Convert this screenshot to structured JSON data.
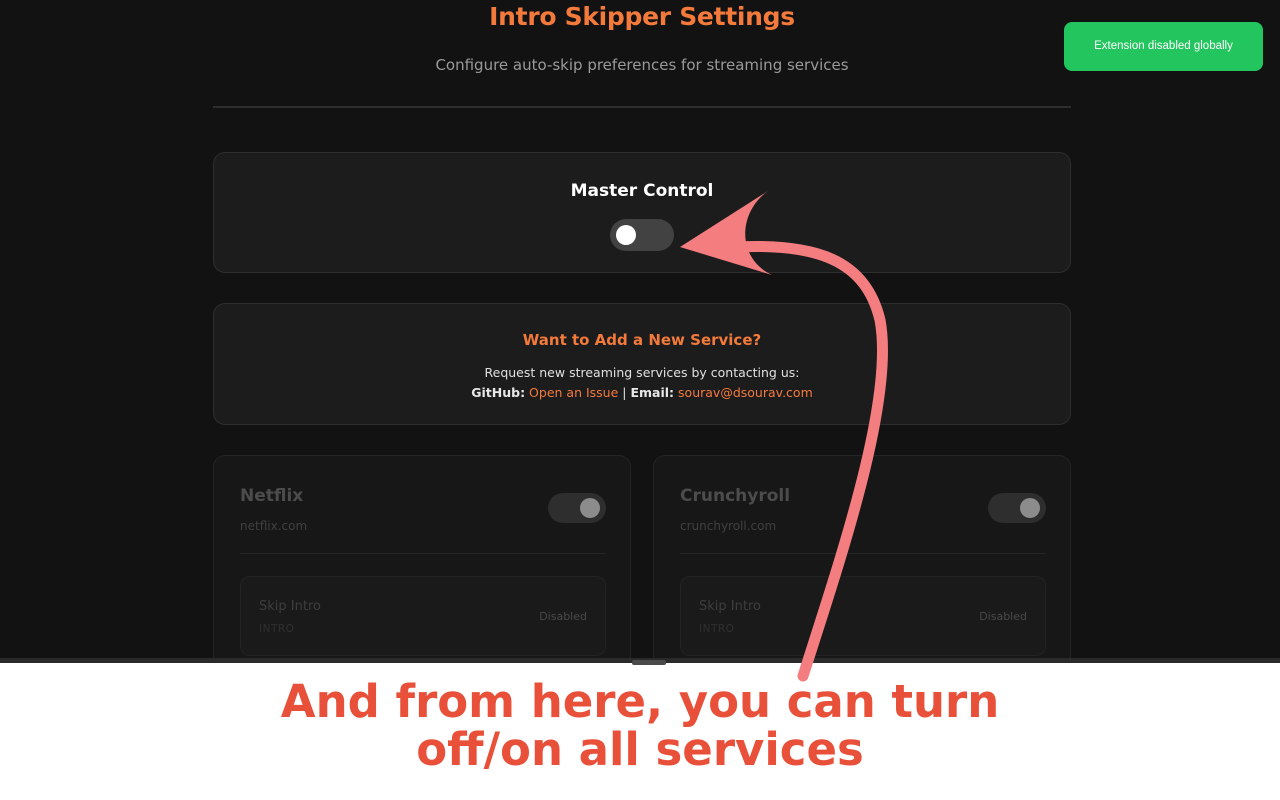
{
  "header": {
    "title": "Intro Skipper Settings",
    "subtitle": "Configure auto-skip preferences for streaming services"
  },
  "master_control": {
    "label": "Master Control",
    "enabled": false
  },
  "add_service": {
    "title": "Want to Add a New Service?",
    "description": "Request new streaming services by contacting us:",
    "github_label": "GitHub:",
    "github_link": "Open an Issue",
    "separator": "|",
    "email_label": "Email:",
    "email_link": "sourav@dsourav.com"
  },
  "services": [
    {
      "name": "Netflix",
      "domain": "netflix.com",
      "enabled": true,
      "option": {
        "name": "Skip Intro",
        "tag": "INTRO",
        "status": "Disabled"
      }
    },
    {
      "name": "Crunchyroll",
      "domain": "crunchyroll.com",
      "enabled": true,
      "option": {
        "name": "Skip Intro",
        "tag": "INTRO",
        "status": "Disabled"
      }
    }
  ],
  "toast": {
    "message": "Extension disabled globally"
  },
  "annotation": {
    "line1": "And from here, you can turn",
    "line2": "off/on all services"
  },
  "colors": {
    "accent": "#f47a3c",
    "toast": "#22c55e",
    "annotation": "#e8503a",
    "arrow": "#f37d7f"
  }
}
